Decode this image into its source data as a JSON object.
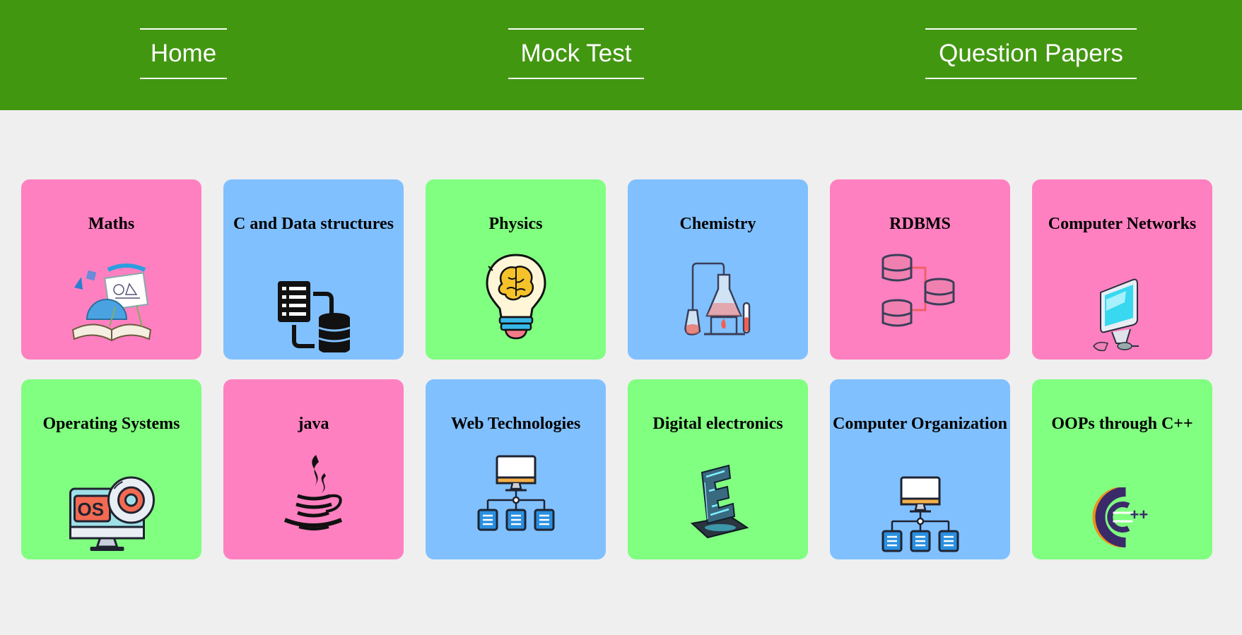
{
  "nav": {
    "home": "Home",
    "mock_test": "Mock Test",
    "question_papers": "Question Papers"
  },
  "colors": {
    "header": "#429711",
    "background": "#efefef",
    "pink": "#ff80c0",
    "blue": "#80c0ff",
    "green": "#80ff80"
  },
  "subjects": [
    {
      "title": "Maths",
      "color": "pink",
      "icon": "maths-icon"
    },
    {
      "title": "C and Data structures",
      "color": "blue",
      "icon": "data-structures-icon"
    },
    {
      "title": "Physics",
      "color": "green",
      "icon": "brain-bulb-icon"
    },
    {
      "title": "Chemistry",
      "color": "blue",
      "icon": "lab-flask-icon"
    },
    {
      "title": "RDBMS",
      "color": "pink",
      "icon": "database-icon"
    },
    {
      "title": "Computer Networks",
      "color": "pink",
      "icon": "computer-icon"
    },
    {
      "title": "Operating Systems",
      "color": "green",
      "icon": "os-disc-icon"
    },
    {
      "title": "java",
      "color": "pink",
      "icon": "java-cup-icon"
    },
    {
      "title": "Web Technologies",
      "color": "blue",
      "icon": "network-hierarchy-icon"
    },
    {
      "title": "Digital electronics",
      "color": "green",
      "icon": "electronics-e-icon"
    },
    {
      "title": "Computer Organization",
      "color": "blue",
      "icon": "network-hierarchy-icon"
    },
    {
      "title": "OOPs through C++",
      "color": "green",
      "icon": "cpp-logo-icon"
    }
  ]
}
